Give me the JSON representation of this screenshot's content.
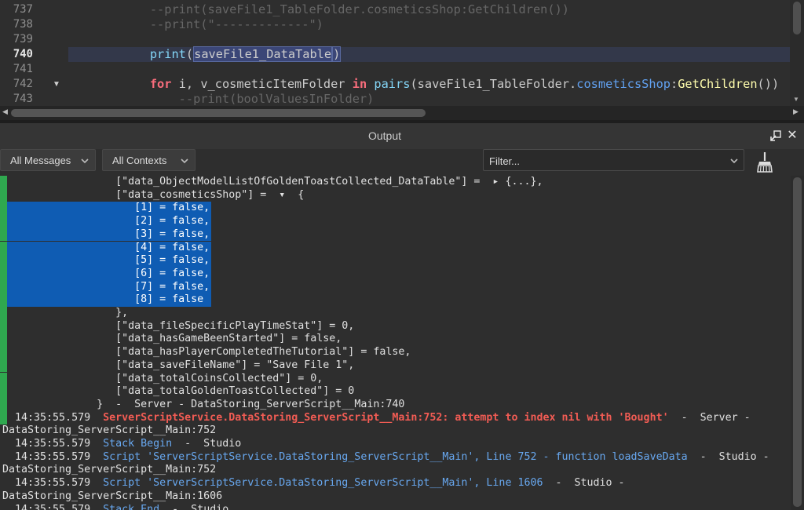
{
  "editor": {
    "lines": [
      {
        "num": "737",
        "fold": "",
        "segments": [
          {
            "t": "    --print(saveFile1_TableFolder.cosmeticsShop:GetChildren())",
            "c": "c-comment"
          }
        ]
      },
      {
        "num": "738",
        "fold": "",
        "segments": [
          {
            "t": "    --print(\"-------------\")",
            "c": "c-comment"
          }
        ]
      },
      {
        "num": "739",
        "fold": "",
        "segments": []
      },
      {
        "num": "740",
        "fold": "",
        "active": true,
        "segments": [
          {
            "t": "    ",
            "c": "c-text"
          },
          {
            "t": "print",
            "c": "c-builtin"
          },
          {
            "t": "(",
            "c": "c-text"
          },
          {
            "t": "saveFile1_DataTable",
            "c": "c-text c-sel"
          },
          {
            "t": ")",
            "c": "c-text c-sel"
          }
        ]
      },
      {
        "num": "741",
        "fold": "",
        "segments": []
      },
      {
        "num": "742",
        "fold": "▼",
        "segments": [
          {
            "t": "    ",
            "c": "c-text"
          },
          {
            "t": "for",
            "c": "c-kw"
          },
          {
            "t": " i, v_cosmeticItemFolder ",
            "c": "c-text"
          },
          {
            "t": "in",
            "c": "c-kw"
          },
          {
            "t": " ",
            "c": "c-text"
          },
          {
            "t": "pairs",
            "c": "c-builtin"
          },
          {
            "t": "(saveFile1_TableFolder.",
            "c": "c-text"
          },
          {
            "t": "cosmeticsShop",
            "c": "c-prop"
          },
          {
            "t": ":",
            "c": "c-text"
          },
          {
            "t": "GetChildren",
            "c": "c-fn"
          },
          {
            "t": "())",
            "c": "c-text"
          }
        ]
      },
      {
        "num": "743",
        "fold": "",
        "segments": [
          {
            "t": "        --print(boolValuesInFolder)",
            "c": "c-comment"
          }
        ]
      }
    ]
  },
  "panel": {
    "title": "Output",
    "message_filter": "All Messages",
    "context_filter": "All Contexts",
    "filter_placeholder": "Filter..."
  },
  "log": [
    {
      "bar": true,
      "indent": "                  ",
      "segments": [
        {
          "t": "[\"data_ObjectModelListOfGoldenToastCollected_DataTable\"] =  ▸ {...},",
          "c": "c-grey"
        }
      ]
    },
    {
      "bar": true,
      "indent": "                  ",
      "segments": [
        {
          "t": "[\"data_cosmeticsShop\"] =  ▾  {",
          "c": "c-grey"
        }
      ]
    },
    {
      "bar": true,
      "sel": true,
      "indent": "                     ",
      "segments": [
        {
          "t": "[1] = false,",
          "c": ""
        }
      ]
    },
    {
      "bar": true,
      "sel": true,
      "indent": "                     ",
      "segments": [
        {
          "t": "[2] = false,",
          "c": ""
        }
      ]
    },
    {
      "bar": true,
      "sel": true,
      "indent": "                     ",
      "segments": [
        {
          "t": "[3] = false,",
          "c": ""
        }
      ]
    },
    {
      "bar": true,
      "sel": true,
      "indent": "                     ",
      "segments": [
        {
          "t": "[4] = false,",
          "c": ""
        }
      ]
    },
    {
      "bar": true,
      "sel": true,
      "indent": "                     ",
      "segments": [
        {
          "t": "[5] = false,",
          "c": ""
        }
      ]
    },
    {
      "bar": true,
      "sel": true,
      "indent": "                     ",
      "segments": [
        {
          "t": "[6] = false,",
          "c": ""
        }
      ]
    },
    {
      "bar": true,
      "sel": true,
      "indent": "                     ",
      "segments": [
        {
          "t": "[7] = false,",
          "c": ""
        }
      ]
    },
    {
      "bar": true,
      "sel": true,
      "indent": "                     ",
      "segments": [
        {
          "t": "[8] = false",
          "c": ""
        }
      ]
    },
    {
      "bar": true,
      "indent": "                  ",
      "segments": [
        {
          "t": "},",
          "c": "c-grey"
        }
      ]
    },
    {
      "bar": true,
      "indent": "                  ",
      "segments": [
        {
          "t": "[\"data_fileSpecificPlayTimeStat\"] = 0,",
          "c": "c-grey"
        }
      ]
    },
    {
      "bar": true,
      "indent": "                  ",
      "segments": [
        {
          "t": "[\"data_hasGameBeenStarted\"] = false,",
          "c": "c-grey"
        }
      ]
    },
    {
      "bar": true,
      "indent": "                  ",
      "segments": [
        {
          "t": "[\"data_hasPlayerCompletedTheTutorial\"] = false,",
          "c": "c-grey"
        }
      ]
    },
    {
      "bar": true,
      "indent": "                  ",
      "segments": [
        {
          "t": "[\"data_saveFileName\"] = \"Save File 1\",",
          "c": "c-grey"
        }
      ]
    },
    {
      "bar": true,
      "indent": "                  ",
      "segments": [
        {
          "t": "[\"data_totalCoinsCollected\"] = 0,",
          "c": "c-grey"
        }
      ]
    },
    {
      "bar": true,
      "indent": "                  ",
      "segments": [
        {
          "t": "[\"data_totalGoldenToastCollected\"] = 0",
          "c": "c-grey"
        }
      ]
    },
    {
      "bar": true,
      "indent": "               ",
      "segments": [
        {
          "t": "}  -  Server - DataStoring_ServerScript__Main:740",
          "c": "c-grey"
        }
      ]
    },
    {
      "bar": true,
      "indent": "  ",
      "segments": [
        {
          "t": "14:35:55.579  ",
          "c": "c-grey"
        },
        {
          "t": "ServerScriptService.DataStoring_ServerScript__Main:752: attempt to index nil with 'Bought'",
          "c": "c-red"
        },
        {
          "t": "  -  Server -",
          "c": "c-grey"
        }
      ]
    },
    {
      "bar": false,
      "indent": "",
      "segments": [
        {
          "t": "DataStoring_ServerScript__Main:752",
          "c": "c-grey"
        }
      ]
    },
    {
      "bar": false,
      "indent": "  ",
      "segments": [
        {
          "t": "14:35:55.579  ",
          "c": "c-grey"
        },
        {
          "t": "Stack Begin",
          "c": "c-blue"
        },
        {
          "t": "  -  Studio",
          "c": "c-grey"
        }
      ]
    },
    {
      "bar": false,
      "indent": "  ",
      "segments": [
        {
          "t": "14:35:55.579  ",
          "c": "c-grey"
        },
        {
          "t": "Script 'ServerScriptService.DataStoring_ServerScript__Main', Line 752 - function loadSaveData",
          "c": "c-blue"
        },
        {
          "t": "  -  Studio -",
          "c": "c-grey"
        }
      ]
    },
    {
      "bar": false,
      "indent": "",
      "segments": [
        {
          "t": "DataStoring_ServerScript__Main:752",
          "c": "c-grey"
        }
      ]
    },
    {
      "bar": false,
      "indent": "  ",
      "segments": [
        {
          "t": "14:35:55.579  ",
          "c": "c-grey"
        },
        {
          "t": "Script 'ServerScriptService.DataStoring_ServerScript__Main', Line 1606",
          "c": "c-blue"
        },
        {
          "t": "  -  Studio -",
          "c": "c-grey"
        }
      ]
    },
    {
      "bar": false,
      "indent": "",
      "segments": [
        {
          "t": "DataStoring_ServerScript__Main:1606",
          "c": "c-grey"
        }
      ]
    },
    {
      "bar": false,
      "indent": "  ",
      "segments": [
        {
          "t": "14:35:55.579  ",
          "c": "c-grey"
        },
        {
          "t": "Stack End",
          "c": "c-blue"
        },
        {
          "t": "  -  Studio",
          "c": "c-grey"
        }
      ]
    }
  ],
  "icons": {
    "undock": "undock-icon",
    "close": "close-icon",
    "clear": "broom-icon",
    "dropdown": "chevron-down-icon",
    "fold": "fold-arrow-icon"
  },
  "colors": {
    "background": "#2e2e2e",
    "selection": "#0f5cb3",
    "gutter_bar": "#2fa84f",
    "error": "#f25c54",
    "info": "#68a8f0"
  }
}
